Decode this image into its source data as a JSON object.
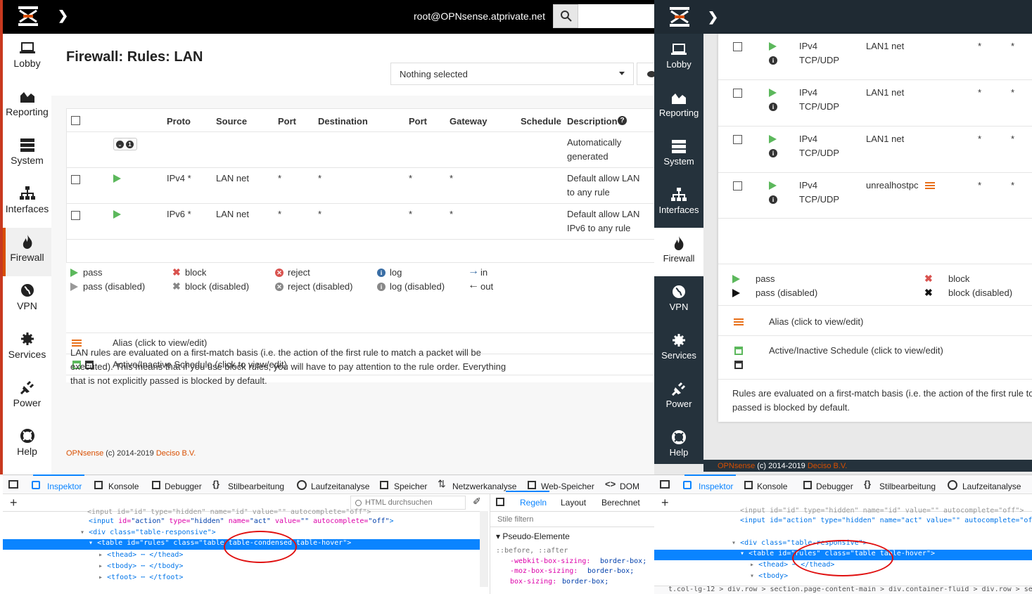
{
  "left": {
    "user": "root@OPNsense.atprivate.net",
    "page_title": "Firewall: Rules: LAN",
    "select_value": "Nothing selected",
    "nav": [
      "Lobby",
      "Reporting",
      "System",
      "Interfaces",
      "Firewall",
      "VPN",
      "Services",
      "Power",
      "Help"
    ],
    "columns": [
      "Proto",
      "Source",
      "Port",
      "Destination",
      "Port",
      "Gateway",
      "Schedule",
      "Description"
    ],
    "auto_badge": "1",
    "auto_desc": [
      "Automatically",
      "generated"
    ],
    "rows": [
      {
        "proto": "IPv4 *",
        "source": "LAN net",
        "port": "*",
        "dest": "*",
        "dport": "*",
        "gateway": "*",
        "desc": [
          "Default allow LAN",
          "to any rule"
        ]
      },
      {
        "proto": "IPv6 *",
        "source": "LAN net",
        "port": "*",
        "dest": "*",
        "dport": "*",
        "gateway": "*",
        "desc": [
          "Default allow LAN",
          "IPv6 to any rule"
        ]
      }
    ],
    "legend": {
      "pass": "pass",
      "pass_disabled": "pass (disabled)",
      "block": "block",
      "block_disabled": "block (disabled)",
      "reject": "reject",
      "reject_disabled": "reject (disabled)",
      "log": "log",
      "log_disabled": "log (disabled)",
      "in": "in",
      "out": "out",
      "alias": "Alias (click to view/edit)",
      "schedule": "Active/Inactive Schedule (click to view/edit)"
    },
    "note": [
      "LAN rules are evaluated on a first-match basis (i.e. the action of the first rule to match a packet will be",
      "executed). This means that if you use block rules, you will have to pay attention to the rule order. Everything",
      "that is not explicitly passed is blocked by default."
    ],
    "footer": {
      "brand": "OPNsense",
      "copy": " (c) 2014-2019 ",
      "company": "Deciso B.V."
    }
  },
  "devtools_left": {
    "tabs": [
      "Inspektor",
      "Konsole",
      "Debugger",
      "Stilbearbeitung",
      "Laufzeitanalyse",
      "Speicher",
      "Netzwerkanalyse",
      "Web-Speicher",
      "DOM"
    ],
    "search_placeholder": "HTML durchsuchen",
    "side_tabs": [
      "Regeln",
      "Layout",
      "Berechnet"
    ],
    "filter_placeholder": "Stile filtern",
    "pseudo": "Pseudo-Elemente",
    "pseudo_sel": "::before, ::after",
    "css": [
      "-webkit-box-sizing:",
      "border-box;",
      "-moz-box-sizing:",
      "border-box;",
      "box-sizing:",
      "border-box;"
    ],
    "lines": {
      "l0": "<input id=\"id\" type=\"hidden\" name=\"id\" value=\"\" autocomplete=\"off\">",
      "l1a": "<input ",
      "l1b": "id=",
      "l1c": "\"action\" ",
      "l1d": "type=",
      "l1e": "\"hidden\" ",
      "l1f": "name=",
      "l1g": "\"act\" ",
      "l1h": "value=",
      "l1i": "\"\" ",
      "l1j": "autocomplete=",
      "l1k": "\"off\"",
      "l1l": ">",
      "l2": "<div class=\"table-responsive\">",
      "l3": "<table id=\"rules\" class=\"table table-condensed table-hover\">",
      "l4": "<thead> ⋯ </thead>",
      "l5": "<tbody> ⋯ </tbody>",
      "l6": "<tfoot> ⋯ </tfoot>"
    }
  },
  "right": {
    "nav": [
      "Lobby",
      "Reporting",
      "System",
      "Interfaces",
      "Firewall",
      "VPN",
      "Services",
      "Power",
      "Help"
    ],
    "rows": [
      {
        "proto1": "IPv4",
        "proto2": "TCP/UDP",
        "source": "LAN1 net",
        "port": "*",
        "dest": "*"
      },
      {
        "proto1": "IPv4",
        "proto2": "TCP/UDP",
        "source": "LAN1 net",
        "port": "*",
        "dest": "*"
      },
      {
        "proto1": "IPv4",
        "proto2": "TCP/UDP",
        "source": "LAN1 net",
        "port": "*",
        "dest": "*"
      },
      {
        "proto1": "IPv4",
        "proto2": "TCP/UDP",
        "source": "unrealhostpc",
        "port": "*",
        "dest": "*"
      }
    ],
    "legend": {
      "pass": "pass",
      "pass_disabled": "pass (disabled)",
      "block": "block",
      "block_disabled": "block (disabled)",
      "alias": "Alias (click to view/edit)",
      "schedule": "Active/Inactive Schedule (click to view/edit)"
    },
    "note": [
      "Rules are evaluated on a first-match basis (i.e. the action of the first rule to",
      "passed is blocked by default."
    ],
    "footer": {
      "brand": "OPNsense",
      "copy": " (c) 2014-2019 ",
      "company": "Deciso B.V."
    }
  },
  "devtools_right": {
    "tabs": [
      "Inspektor",
      "Konsole",
      "Debugger",
      "Stilbearbeitung",
      "Laufzeitanalyse"
    ],
    "lines": {
      "l0": "<input id=\"id\" type=\"hidden\" name=\"id\" value=\"\" autocomplete=\"off\">",
      "l1": "<input id=\"action\" type=\"hidden\" name=\"act\" value=\"\" autocomplete=\"of",
      "l2": "<div class=\"table-responsive\">",
      "l3": "<table id=\"rules\" class=\"table table-hover\">",
      "l4": "<thead> ⋯ </thead>",
      "l5": "<tbody>"
    },
    "breadcrumb": "t.col-lg-12 > div.row > section.page-content-main > div.container-fluid > div.row > section.col-1"
  },
  "colors": {
    "accent": "#d94f00",
    "pass": "#5cb85c",
    "block": "#d9534f",
    "devtools_select": "#0a84ff",
    "annotation": "#e01010"
  }
}
